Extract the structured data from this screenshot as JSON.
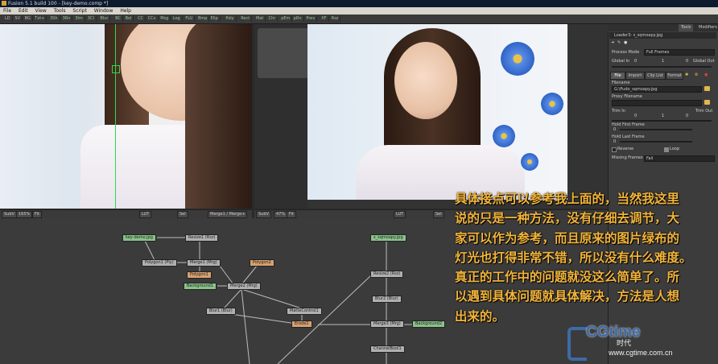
{
  "titlebar": {
    "title": "Fusion 5.1 build 100 - [key-demo.comp *]"
  },
  "menubar": {
    "items": [
      "File",
      "Edit",
      "View",
      "Tools",
      "Script",
      "Window",
      "Help"
    ]
  },
  "toolbar": {
    "tools": [
      "LD",
      "SV",
      "BG",
      "Txt+",
      "3Sh",
      "3Rn",
      "3Im",
      "3Cl",
      "Blur",
      "BC",
      "Bol",
      "CC",
      "CCv",
      "Msg",
      "Log",
      "FLU",
      "Bmp",
      "Elip",
      "Poly",
      "Rect",
      "Mat",
      "Chr",
      "pEm",
      "pRn",
      "Prev",
      "XF",
      "Rsz"
    ]
  },
  "viewer1": {
    "bar": {
      "view": "SubV",
      "zoom": "165%",
      "fit": "Fit",
      "lut": "LUT",
      "sel": "Sel",
      "merge_node": "Merge1 / Merge+"
    }
  },
  "viewer2": {
    "bar": {
      "view": "SubV",
      "zoom": "47%",
      "fit": "Fit",
      "lut": "LUT",
      "sel": "Sel"
    }
  },
  "merge_label": "Merge1",
  "flow": {
    "nodes": [
      {
        "label": "key-demo.jpg",
        "kind": "loader"
      },
      {
        "label": "Resize1 (Rsz)",
        "kind": "merge"
      },
      {
        "label": "Polygon1 (Ply)",
        "kind": "merge"
      },
      {
        "label": "Merge1 (Mrg)",
        "kind": "merge"
      },
      {
        "label": "Polygon1",
        "kind": "orange"
      },
      {
        "label": "Polygon2",
        "kind": "orange"
      },
      {
        "label": "Background1",
        "kind": "bg"
      },
      {
        "label": "Merge2 (Mrg)",
        "kind": "merge"
      },
      {
        "label": "Blur1 (Blur)",
        "kind": "merge"
      },
      {
        "label": "MatteControl1",
        "kind": "merge"
      },
      {
        "label": "Erode1",
        "kind": "orange"
      },
      {
        "label": "s_sqmoapy.jpg",
        "kind": "loader"
      },
      {
        "label": "Resize2 (Rsz)",
        "kind": "merge"
      },
      {
        "label": "Blur2 (Blur)",
        "kind": "merge"
      },
      {
        "label": "Merge3 (Mrg)",
        "kind": "merge"
      },
      {
        "label": "Background2",
        "kind": "bg"
      },
      {
        "label": "ChannelBool1",
        "kind": "merge"
      }
    ]
  },
  "panel": {
    "tabs": [
      "Tools",
      "Modifiers"
    ],
    "node_title": "Loader3: s_sqmoapy.jpg",
    "process_mode_label": "Process Mode",
    "process_mode_value": "Full Frames",
    "global_in_label": "Global In",
    "global_out_label": "Global Out",
    "global_in_value": "0",
    "global_mid_value": "1",
    "global_out_value": "0",
    "subtabs": [
      "File",
      "Import",
      "Clip List",
      "Format"
    ],
    "filename_label": "Filename",
    "filename_value": "G:\\Pudo_sqmoapy.jpg",
    "proxy_label": "Proxy Filename",
    "trim_in_label": "Trim In",
    "trim_out_label": "Trim Out",
    "trim_in_value": "0",
    "trim_mid_value": "1",
    "trim_out_value": "0",
    "hold_first_label": "Hold First Frame",
    "hold_last_label": "Hold Last Frame",
    "hold_value": "0",
    "reverse_label": "Reverse",
    "loop_label": "Loop",
    "missing_frames_label": "Missing Frames",
    "missing_frames_value": "Fail"
  },
  "overlay": {
    "lines": [
      "具体接点可以参考我上面的，当然我这里",
      "说的只是一种方法，没有仔细去调节，大",
      "家可以作为参考，而且原来的图片绿布的",
      "灯光也打得非常不错，所以没有什么难度。",
      "真正的工作中的问题就没这么简单了。所",
      "以遇到具体问题就具体解决，方法是人想",
      "出来的。"
    ]
  },
  "watermark": {
    "brand": "CGtime",
    "url": "www.cgtime.com.cn",
    "cn": "时代"
  },
  "colors": {
    "overlay_text": "#f2b43a",
    "loader_node": "#8ac28a",
    "guide": "#2fd84a",
    "watermark": "#3e6aa6"
  }
}
